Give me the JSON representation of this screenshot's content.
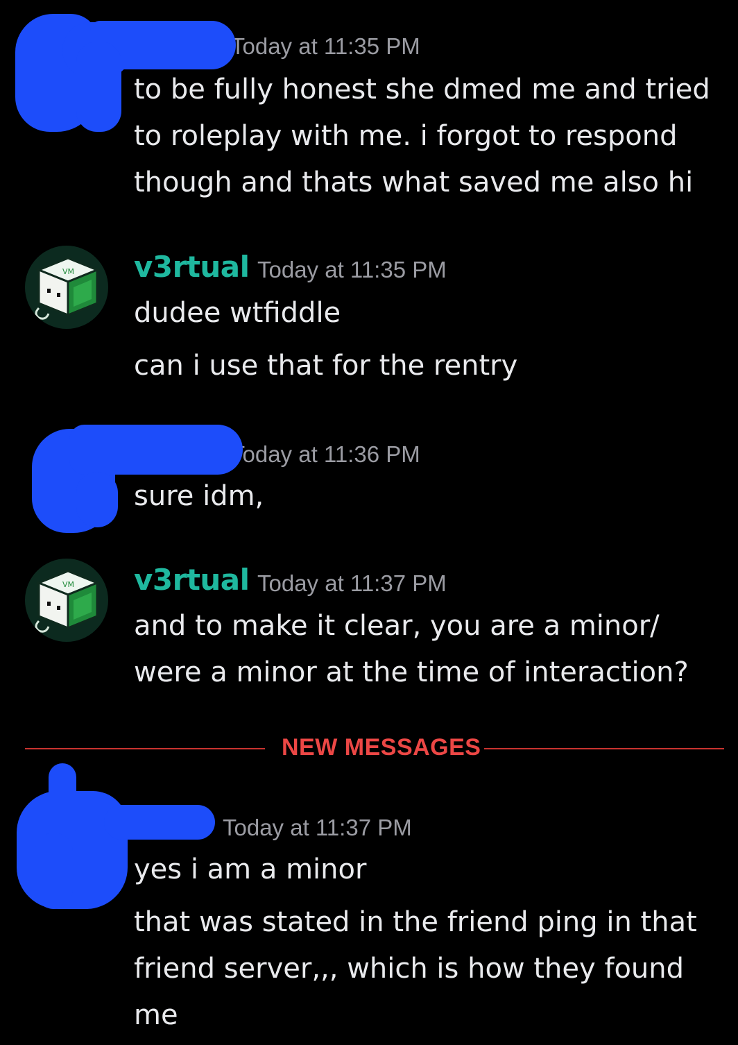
{
  "divider": {
    "label": "NEW MESSAGES",
    "color": "#ec4745"
  },
  "groups": [
    {
      "author": "",
      "author_redacted": true,
      "timestamp": "Today at 11:35 PM",
      "lines": [
        "to be fully honest she dmed me and tried",
        "to roleplay with me. i forgot to respond",
        "though and thats what saved me also hi"
      ]
    },
    {
      "author": "v3rtual",
      "author_color": "#1fb89f",
      "avatar_icon": "vm-cube-icon",
      "timestamp": "Today at 11:35 PM",
      "messages": [
        "dudee wtfiddle",
        "can i use that for the rentry"
      ]
    },
    {
      "author": "",
      "author_redacted": true,
      "timestamp": "Today at 11:36 PM",
      "messages": [
        "sure idm,"
      ]
    },
    {
      "author": "v3rtual",
      "author_color": "#1fb89f",
      "avatar_icon": "vm-cube-icon",
      "timestamp": "Today at 11:37 PM",
      "lines": [
        "and to make it clear, you are a minor/",
        "were a minor at the time of interaction?"
      ]
    },
    {
      "author": "",
      "author_redacted": true,
      "timestamp": "Today at 11:37 PM",
      "messages": [
        "yes i am a minor"
      ],
      "lines": [
        "that was stated in the friend ping in that",
        "friend server,,, which is how they found",
        "me"
      ]
    }
  ],
  "redaction_color": "#1d4dfa",
  "vm_label": "VM"
}
